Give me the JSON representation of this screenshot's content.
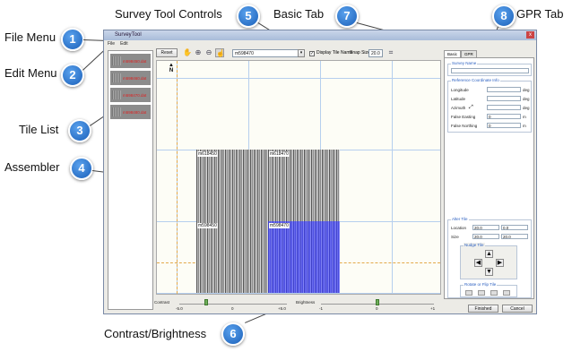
{
  "callouts": {
    "file_menu": {
      "label": "File Menu",
      "num": "1"
    },
    "edit_menu": {
      "label": "Edit Menu",
      "num": "2"
    },
    "tile_list": {
      "label": "Tile List",
      "num": "3"
    },
    "assembler": {
      "label": "Assembler",
      "num": "4"
    },
    "survey_tool_controls": {
      "label": "Survey Tool Controls",
      "num": "5"
    },
    "contrast_brightness": {
      "label": "Contrast/Brightness",
      "num": "6"
    },
    "basic_tab": {
      "label": "Basic Tab",
      "num": "7"
    },
    "gpr_tab": {
      "label": "GPR Tab",
      "num": "8"
    }
  },
  "window": {
    "title": "SurveyTool",
    "close": "x"
  },
  "menu": {
    "file": "File",
    "edit": "Edit"
  },
  "tiles": [
    {
      "name": "m598450.dat"
    },
    {
      "name": "m598460.dat"
    },
    {
      "name": "m598470.dat"
    },
    {
      "name": "m598480.dat"
    }
  ],
  "toolbar": {
    "reset": "Reset",
    "tile_select": "m598470",
    "display_tile_name": "Display Tile Name",
    "snap_size_label": "Snap Size",
    "snap_size_value": "20.0"
  },
  "canvas_tiles": {
    "a": "m618450",
    "b": "m618470",
    "c": "m598450",
    "d": "m598470"
  },
  "compass": "N",
  "sliders": {
    "contrast": {
      "label": "Contrast",
      "min": "-5.0",
      "mid": "0",
      "max": "+5.0",
      "value": 0.25
    },
    "brightness": {
      "label": "Brightness",
      "min": "-1",
      "mid": "0",
      "max": "+1",
      "value": 0.5
    }
  },
  "tabs": {
    "basic": "Basic",
    "gpr": "GPR"
  },
  "basic": {
    "survey_name": "Survey Name",
    "ref_coord": "Reference Coordinate Info",
    "longitude": "Longitude",
    "latitude": "Latitude",
    "azimuth": "Azimuth",
    "false_easting": "False Easting",
    "false_northing": "False Northing",
    "deg": "deg",
    "m": "m",
    "false_easting_value": "0",
    "false_northing_value": "0",
    "alter_tile": "Alter Tile",
    "location": "Location",
    "size": "Size",
    "loc_x": "20.0",
    "loc_y": "0.0",
    "size_x": "20.0",
    "size_y": "20.0",
    "nudge_tile": "Nudge Tile",
    "rotate_flip": "Rotate or Flip Tile"
  },
  "buttons": {
    "finished": "Finished",
    "cancel": "Cancel"
  }
}
